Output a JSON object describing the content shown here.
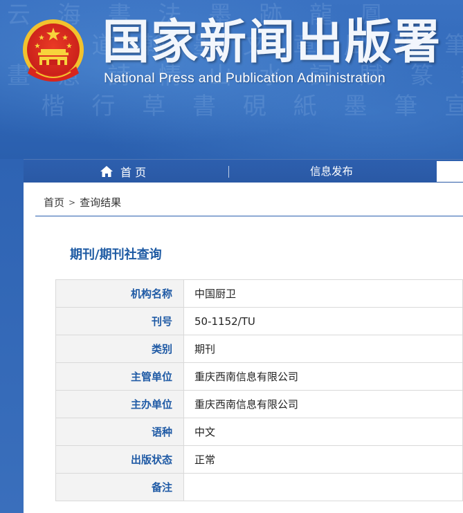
{
  "header": {
    "title": "国家新闻出版署",
    "subtitle": "National  Press and Publication Administration"
  },
  "nav": {
    "home_label": "首 页",
    "info_label": "信息发布"
  },
  "breadcrumb": {
    "home": "首页",
    "separator": ">",
    "current": "查询结果"
  },
  "section": {
    "title": "期刊/期刊社查询"
  },
  "table": {
    "rows": [
      {
        "label": "机构名称",
        "value": "中国厨卫"
      },
      {
        "label": "刊号",
        "value": "50-1152/TU"
      },
      {
        "label": "类别",
        "value": "期刊"
      },
      {
        "label": "主管单位",
        "value": "重庆西南信息有限公司"
      },
      {
        "label": "主办单位",
        "value": "重庆西南信息有限公司"
      },
      {
        "label": "语种",
        "value": "中文"
      },
      {
        "label": "出版状态",
        "value": "正常"
      },
      {
        "label": "备注",
        "value": ""
      }
    ]
  },
  "colors": {
    "header_blue": "#2f66b6",
    "label_blue": "#1f5aa5",
    "title_blue": "#1d5aa3",
    "emblem_red": "#d8251c",
    "emblem_gold": "#f2c22e"
  },
  "icons": {
    "home": "home-icon",
    "emblem": "national-emblem-icon"
  }
}
